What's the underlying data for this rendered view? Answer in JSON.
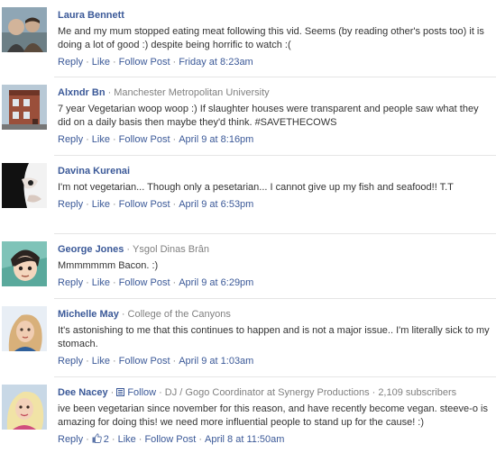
{
  "comments": [
    {
      "name": "Laura Bennett",
      "affiliation": "",
      "text": "Me and my mum stopped eating meat following this vid. Seems (by reading other's posts too) it is doing a lot of good :) despite being horrific to watch :(",
      "actions": {
        "reply": "Reply",
        "like": "Like",
        "follow": "Follow Post"
      },
      "time": "Friday at 8:23am"
    },
    {
      "name": "Alxndr Bn",
      "affiliation": "Manchester Metropolitan University",
      "text": "7 year Vegetarian woop woop :) If slaughter houses were transparent and people saw what they did on a daily basis then maybe they'd think. #SAVETHECOWS",
      "actions": {
        "reply": "Reply",
        "like": "Like",
        "follow": "Follow Post"
      },
      "time": "April 9 at 8:16pm"
    },
    {
      "name": "Davina Kurenai",
      "affiliation": "",
      "text": "I'm not vegetarian... Though only a pesetarian... I cannot give up my fish and seafood!! T.T",
      "actions": {
        "reply": "Reply",
        "like": "Like",
        "follow": "Follow Post"
      },
      "time": "April 9 at 6:53pm"
    },
    {
      "name": "George Jones",
      "affiliation": "Ysgol Dinas Brân",
      "text": "Mmmmmmm Bacon. :)",
      "actions": {
        "reply": "Reply",
        "like": "Like",
        "follow": "Follow Post"
      },
      "time": "April 9 at 6:29pm"
    },
    {
      "name": "Michelle May",
      "affiliation": "College of the Canyons",
      "text": "It's astonishing to me that this continues to happen and is not a major issue.. I'm literally sick to my stomach.",
      "actions": {
        "reply": "Reply",
        "like": "Like",
        "follow": "Follow Post"
      },
      "time": "April 9 at 1:03am"
    },
    {
      "name": "Dee Nacey",
      "follow_label": "Follow",
      "affiliation": "DJ / Gogo Coordinator at Synergy Productions",
      "subscribers": "2,109 subscribers",
      "text": "ive been vegetarian since november for this reason, and have recently become vegan. steeve-o is amazing for doing this! we need more influential people to stand up for the cause! :)",
      "actions": {
        "reply": "Reply",
        "like_count": "2",
        "like": "Like",
        "follow": "Follow Post"
      },
      "time": "April 8 at 11:50am"
    }
  ],
  "colors": {
    "link": "#3b5998",
    "meta": "#808080",
    "text": "#333333",
    "separator": "#e5e5e5"
  }
}
